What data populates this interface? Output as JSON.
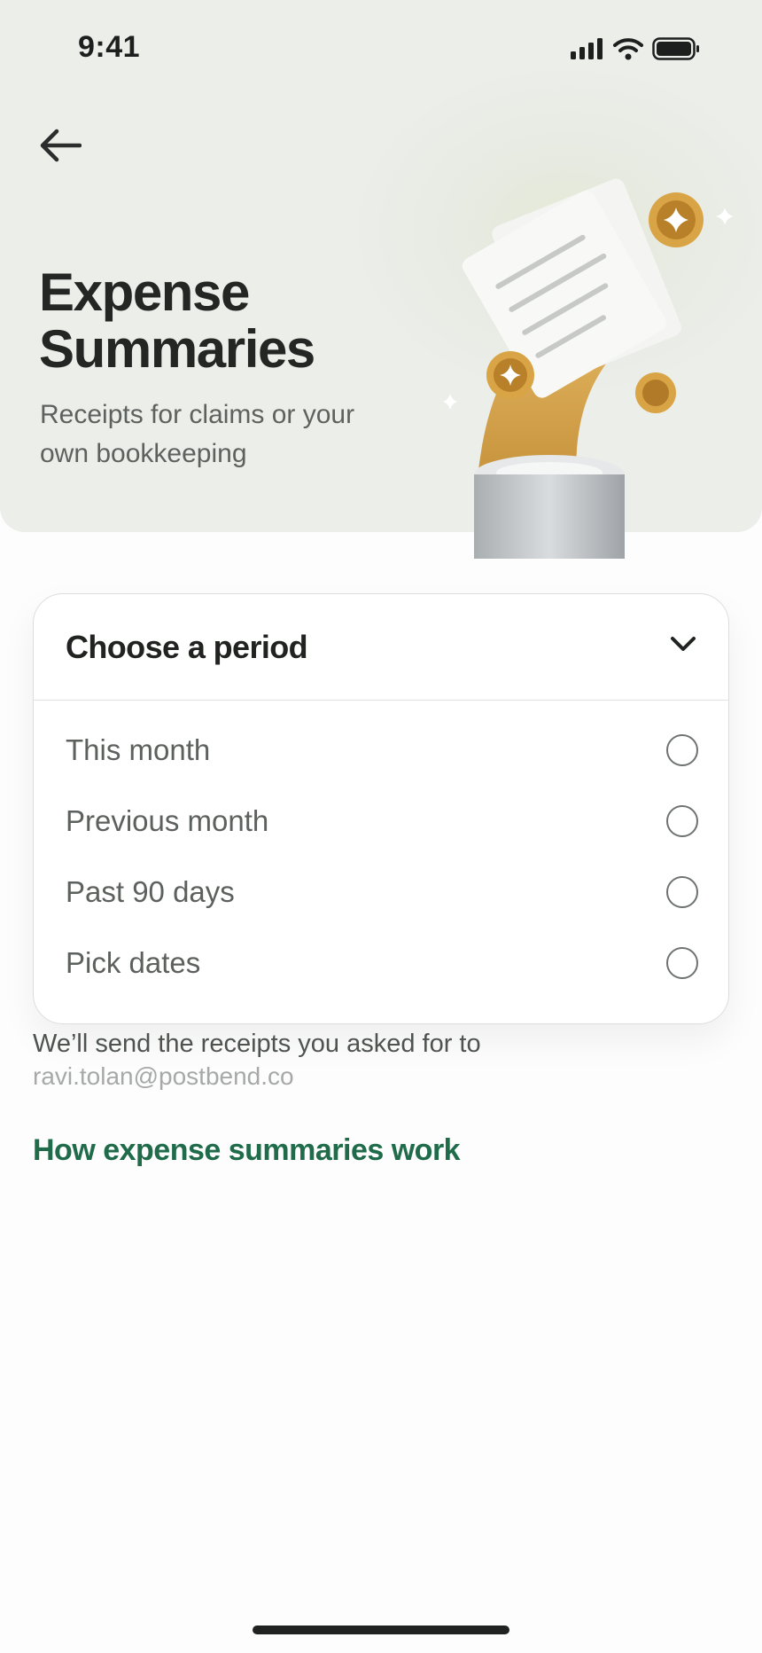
{
  "status_bar": {
    "time": "9:41"
  },
  "header": {
    "title_line1": "Expense",
    "title_line2": "Summaries",
    "subtitle": "Receipts for claims or your own bookkeeping"
  },
  "period_picker": {
    "title": "Choose a period",
    "options": [
      {
        "label": "This month"
      },
      {
        "label": "Previous month"
      },
      {
        "label": "Past 90 days"
      },
      {
        "label": "Pick dates"
      }
    ]
  },
  "delivery": {
    "note": "We’ll send the receipts you asked for to",
    "email": "ravi.tolan@postbend.co"
  },
  "help_link": "How expense summaries work",
  "colors": {
    "accent_green": "#1f6b4a",
    "gold": "#d4a24c",
    "header_bg": "#eceeea"
  }
}
